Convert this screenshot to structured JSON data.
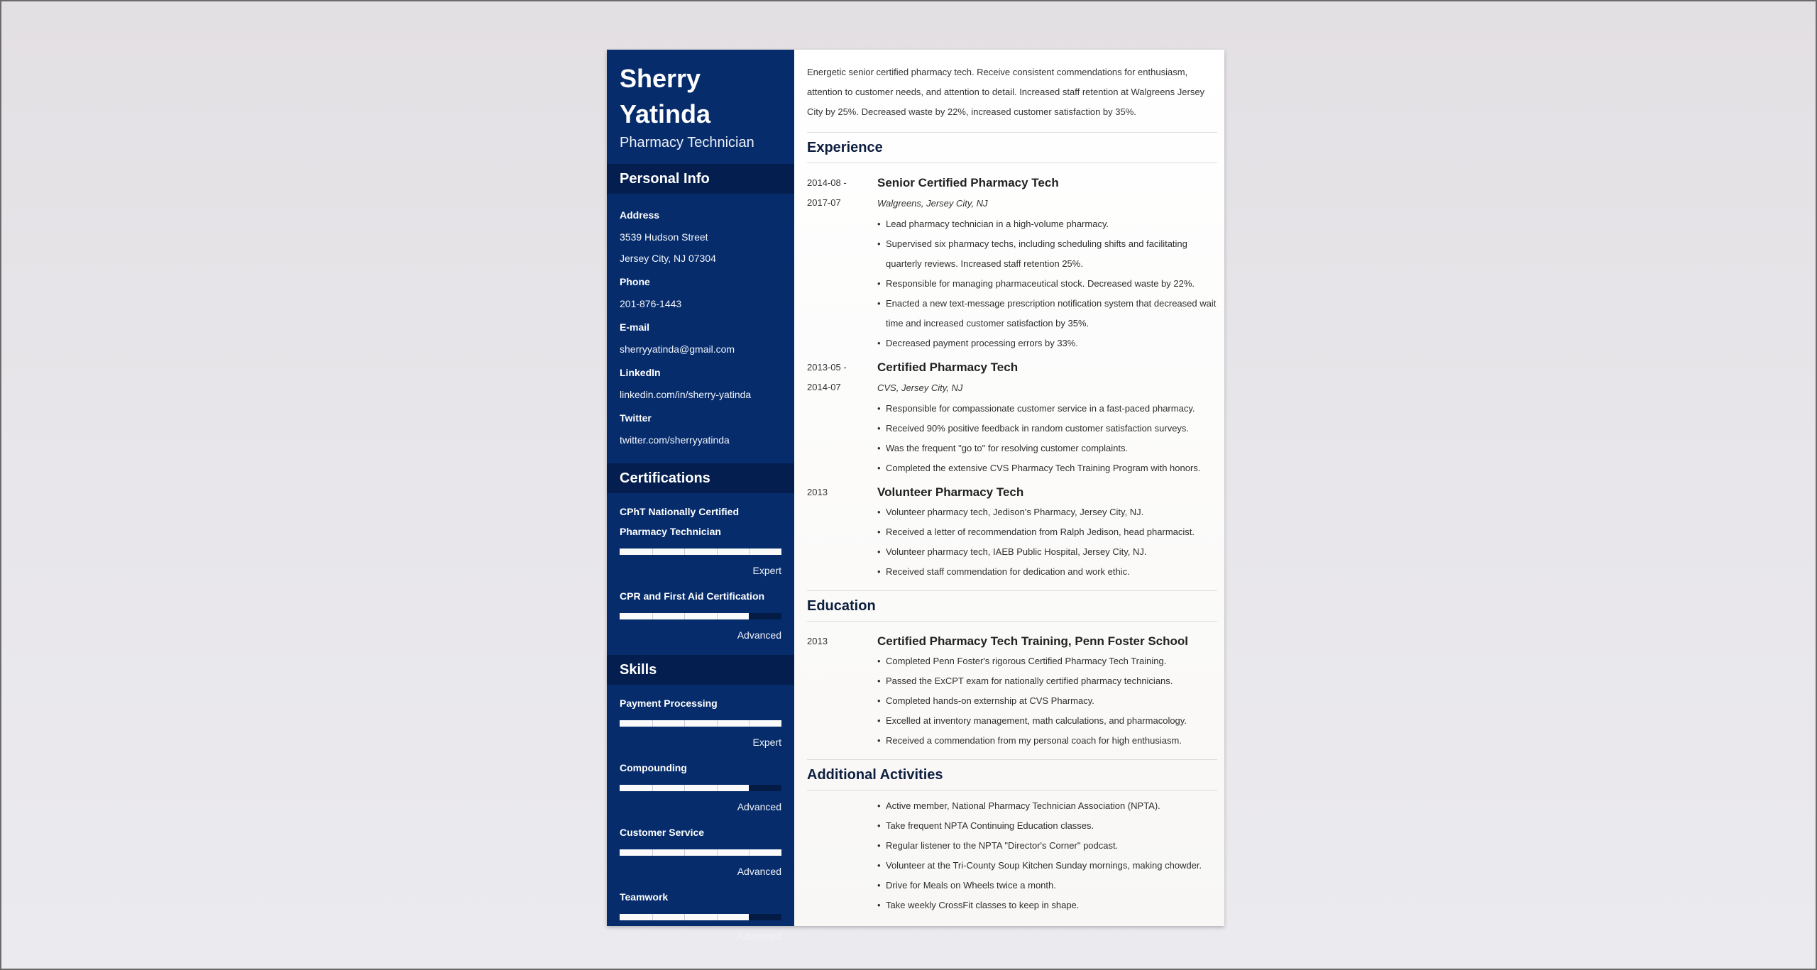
{
  "header": {
    "first_name": "Sherry",
    "last_name": "Yatinda",
    "title": "Pharmacy Technician"
  },
  "sidebar": {
    "personal_info": {
      "heading": "Personal Info",
      "address_label": "Address",
      "address_line1": "3539 Hudson Street",
      "address_line2": "Jersey City, NJ 07304",
      "phone_label": "Phone",
      "phone": "201-876-1443",
      "email_label": "E-mail",
      "email": "sherryyatinda@gmail.com",
      "linkedin_label": "LinkedIn",
      "linkedin": "linkedin.com/in/sherry-yatinda",
      "twitter_label": "Twitter",
      "twitter": "twitter.com/sherryyatinda"
    },
    "certifications": {
      "heading": "Certifications",
      "items": [
        {
          "name": "CPhT Nationally Certified Pharmacy Technician",
          "level": "Expert",
          "fill": 1.0
        },
        {
          "name": "CPR and First Aid Certification",
          "level": "Advanced",
          "fill": 0.8
        }
      ]
    },
    "skills": {
      "heading": "Skills",
      "items": [
        {
          "name": "Payment Processing",
          "level": "Expert",
          "fill": 1.0
        },
        {
          "name": "Compounding",
          "level": "Advanced",
          "fill": 0.8
        },
        {
          "name": "Customer Service",
          "level": "Advanced",
          "fill": 1.0
        },
        {
          "name": "Teamwork",
          "level": "Advanced",
          "fill": 0.8
        }
      ]
    }
  },
  "main": {
    "summary": "Energetic senior certified pharmacy tech. Receive consistent commendations for enthusiasm, attention to customer needs, and attention to detail. Increased staff retention at Walgreens Jersey City by 25%. Decreased waste by 22%, increased customer satisfaction by 35%.",
    "experience": {
      "heading": "Experience",
      "entries": [
        {
          "date_start": "2014-08 -",
          "date_end": "2017-07",
          "title": "Senior Certified Pharmacy Tech",
          "company": "Walgreens, Jersey City, NJ",
          "bullets": [
            "Lead pharmacy technician in a high-volume pharmacy.",
            "Supervised six pharmacy techs, including scheduling shifts and facilitating quarterly reviews. Increased staff retention 25%.",
            "Responsible for managing pharmaceutical stock. Decreased waste by 22%.",
            "Enacted a new text-message prescription notification system that decreased wait time and increased customer satisfaction by 35%.",
            "Decreased payment processing errors by 33%."
          ]
        },
        {
          "date_start": "2013-05 -",
          "date_end": "2014-07",
          "title": "Certified Pharmacy Tech",
          "company": "CVS, Jersey City, NJ",
          "bullets": [
            "Responsible for compassionate customer service in a fast-paced pharmacy.",
            "Received 90% positive feedback in random customer satisfaction surveys.",
            "Was the frequent \"go to\" for resolving customer complaints.",
            "Completed the extensive CVS Pharmacy Tech Training Program with honors."
          ]
        },
        {
          "date_start": "2013",
          "date_end": "",
          "title": "Volunteer Pharmacy Tech",
          "company": "",
          "bullets": [
            "Volunteer pharmacy tech, Jedison's Pharmacy, Jersey City, NJ.",
            "Received a letter of recommendation from Ralph Jedison, head pharmacist.",
            "Volunteer pharmacy tech, IAEB Public Hospital, Jersey City, NJ.",
            "Received staff commendation for dedication and work ethic."
          ]
        }
      ]
    },
    "education": {
      "heading": "Education",
      "entries": [
        {
          "date": "2013",
          "title": "Certified Pharmacy Tech Training, Penn Foster School",
          "bullets": [
            "Completed Penn Foster's rigorous Certified Pharmacy Tech Training.",
            "Passed the ExCPT exam for nationally certified pharmacy technicians.",
            "Completed hands-on externship at CVS Pharmacy.",
            "Excelled at inventory management, math calculations, and pharmacology.",
            "Received a commendation from my personal coach for high enthusiasm."
          ]
        }
      ]
    },
    "activities": {
      "heading": "Additional Activities",
      "bullets": [
        "Active member, National Pharmacy Technician Association (NPTA).",
        "Take frequent NPTA Continuing Education classes.",
        "Regular listener to the NPTA \"Director's Corner\" podcast.",
        "Volunteer at the Tri-County Soup Kitchen Sunday mornings, making chowder.",
        "Drive for Meals on Wheels twice a month.",
        "Take weekly CrossFit classes to keep in shape."
      ]
    }
  },
  "colors": {
    "sidebar_bg": "#062c6c",
    "sidebar_heading_bg": "#041f4f",
    "section_title": "#0d1e3f"
  }
}
